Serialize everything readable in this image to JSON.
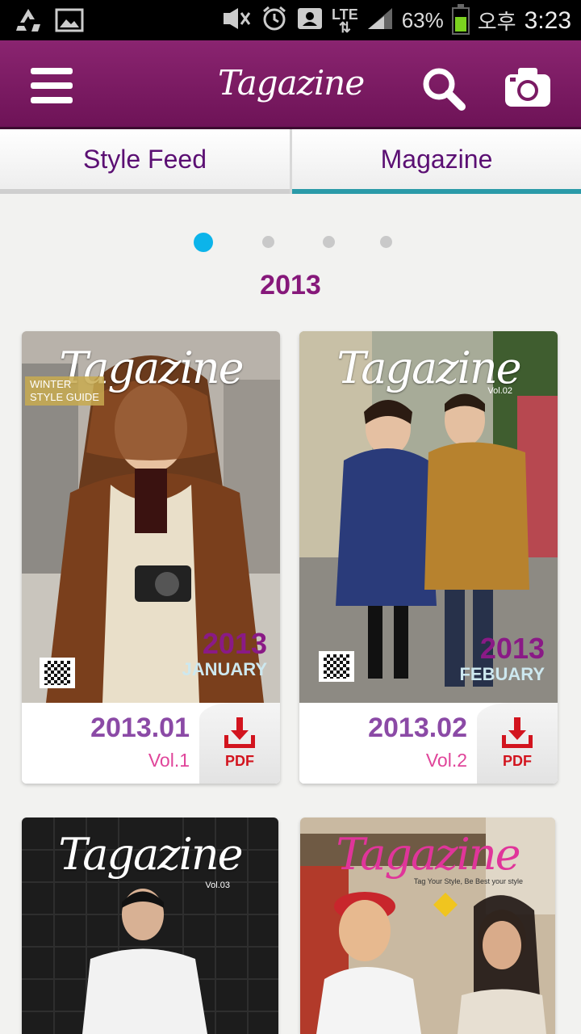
{
  "status_bar": {
    "network": "LTE",
    "battery_percent": "63%",
    "ampm": "오후",
    "time": "3:23",
    "icons": [
      "recycle-icon",
      "image-icon",
      "mute-icon",
      "alarm-icon",
      "contact-icon",
      "signal-icon",
      "battery-icon"
    ]
  },
  "app_bar": {
    "logo": "Tagazine",
    "menu_icon": "hamburger-menu-icon",
    "search_icon": "search-icon",
    "camera_icon": "camera-icon"
  },
  "tabs": [
    {
      "label": "Style Feed",
      "selected": false
    },
    {
      "label": "Magazine",
      "selected": true
    }
  ],
  "pager": {
    "pages": 4,
    "current": 1
  },
  "section": {
    "year": "2013"
  },
  "colors": {
    "app_bar": "#7a1a63",
    "tab_text": "#5b0f73",
    "tab_indicator": "#2a9aa8",
    "year": "#86187a",
    "issue_date": "#8b4aa6",
    "issue_vol": "#e0459a",
    "pdf_red": "#d2141e",
    "active_dot": "#0cb4ea",
    "inactive_dot": "#c9c9c9"
  },
  "magazines": [
    {
      "cover_logo": "Tagazine",
      "cover_badge_line1": "WINTER",
      "cover_badge_line2": "STYLE GUIDE",
      "cover_year": "2013",
      "cover_month": "JANUARY",
      "issue_date": "2013.01",
      "volume": "Vol.1",
      "pdf_label": "PDF"
    },
    {
      "cover_logo": "Tagazine",
      "cover_vol": "Vol.02",
      "cover_year": "2013",
      "cover_month": "FEBUARY",
      "issue_date": "2013.02",
      "volume": "Vol.2",
      "pdf_label": "PDF"
    },
    {
      "cover_logo": "Tagazine",
      "cover_vol": "Vol.03"
    },
    {
      "cover_logo": "Tagazine",
      "cover_tagline": "Tag Your Style, Be Best your style"
    }
  ]
}
